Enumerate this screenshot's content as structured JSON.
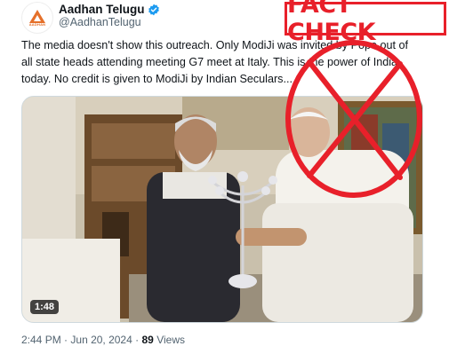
{
  "tweet": {
    "author_name": "Aadhan Telugu",
    "author_handle": "@AadhanTelugu",
    "avatar_brand": "AADHAN",
    "text": "The media doesn't show this outreach. Only ModiJi was invited by Pope out of all state heads attending meeting G7 meet at Italy. This is the power of India today. No credit is given to ModiJi by Indian Seculars...",
    "video_duration": "1:48",
    "time": "2:44 PM",
    "separator": "·",
    "date": "Jun 20, 2024",
    "views_count": "89",
    "views_label": "Views"
  },
  "overlay": {
    "label": "FACT CHECK",
    "color": "#e8202a"
  },
  "colors": {
    "verified": "#1d9bf0",
    "secondary_text": "#536471",
    "brand_orange": "#e5702a"
  },
  "icons": [
    "verified-badge-icon",
    "aadhan-logo-icon",
    "prohibition-sign-icon"
  ]
}
